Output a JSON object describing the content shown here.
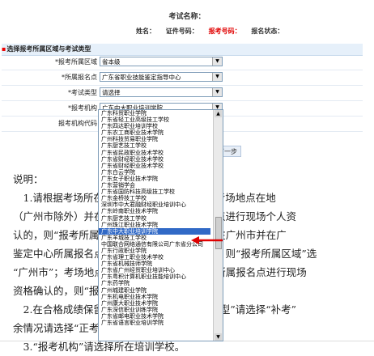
{
  "header": {
    "exam_name_label": "考试名称：",
    "name_label": "姓名：",
    "cert_label": "证件号码：",
    "ticket_label": "报考号码：",
    "status_label": "报名状态："
  },
  "section": {
    "title": "选择报考所属区域与考试类型"
  },
  "form": {
    "area": {
      "label": "*报考所属区域",
      "value": "省本级"
    },
    "center": {
      "label": "*所属报名点",
      "value": "广东省职业技能鉴定指导中心"
    },
    "exam_type": {
      "label": "*考试类型",
      "value": "请选择"
    },
    "org": {
      "label": "*报考机构",
      "value": "广东中大职业培训学院"
    },
    "org_code": {
      "label": "报考机构代码"
    }
  },
  "dropdown_options": [
    "广东科贸职业学院",
    "广东省轻工业高级技工学校",
    "广东四达职业培训学校",
    "广东农工商职业技术学院",
    "广州科技贸易职业学院",
    "广东厨艺技工学校",
    "广东省民政职业技术学校",
    "广东省财经职业技术学校",
    "广东省财经职业技术学校",
    "广东白云学院",
    "广东女子职业技术学院",
    "广东营销学会",
    "广东省国防科技高级技工学校",
    "广东金桥技工学校",
    "深圳市中大君融财经职业培训中心",
    "广东岭南职业技术学院",
    "广东厨艺技工学校",
    "广州珠江职业技术学院",
    "广东中大职业培训学院",
    "广东羊城技工学校",
    "中国联合网络通信有限公司广东省分公司",
    "广东行政职业学院",
    "广东省理工职业技术学校",
    "广东省机械技师学院",
    "广东省广州经贸职业培训中心",
    "广东粤积计算机职业技能培训中心",
    "广东药学院",
    "广州城建职业学院",
    "广东机电职业技术学院",
    "广州康大职业技术学院",
    "广东深信职业训练学院",
    "广东省邮电职业技术学院",
    "广东省语言职业培训学院"
  ],
  "selected_option_index": 18,
  "buttons": {
    "next": "下一步"
  },
  "notes": [
    "说明：",
    "　1.请根据考场所在地选择“报考所属区域”。考场地点在地",
    "（广州市除外）并在该地市鉴定中心所属报名点进行现场个人资",
    "认的，则“报考所属区域”选该地市；考场地点在广州市并在广",
    "鉴定中心所属报名点进行现场个人资格确认的，则“报考所属区域”选",
    "“广州市”；考场地点在广州市并在省鉴定中心所属报名点进行现场",
    "资格确认的，则“报考所属区域”选“省本级”。",
    "　2.在合格成绩保留期内参加补考的，“考试类型”请选择“补考”",
    "余情况请选择“正考”。",
    "　3.“报考机构”请选择所在培训学校。"
  ],
  "colors": {
    "accent_red": "#e00000",
    "selection_blue": "#3169c6",
    "section_bg": "#e6f0fa"
  }
}
